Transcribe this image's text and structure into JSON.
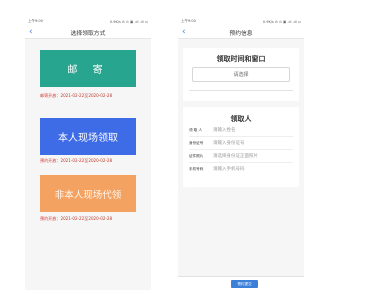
{
  "left": {
    "status": {
      "time": "上午9:00",
      "icons": "0.9K/s ✆ ⊙ ▣ .ıll .ıll ▭"
    },
    "title": "选择领取方式",
    "options": [
      {
        "label": "邮 寄",
        "note_label": "邮寄开放：",
        "note_value": "2021-02-22至2020-02-28"
      },
      {
        "label": "本人现场领取",
        "note_label": "预约开放：",
        "note_value": "2021-02-22至2020-02-28"
      },
      {
        "label": "非本人现场代领",
        "note_label": "预约开放：",
        "note_value": "2021-02-22至2020-02-28"
      }
    ]
  },
  "right": {
    "status": {
      "time": "上午9:00",
      "icons": "0.9K/s ✆ ⊙ ▣ .ıll .ıll ▭"
    },
    "title": "预约信息",
    "time_section": {
      "title": "领取时间和窗口",
      "select_placeholder": "请选择"
    },
    "person_section": {
      "title": "领取人",
      "fields": [
        {
          "label": "领 取 人",
          "placeholder": "请输入姓名"
        },
        {
          "label": "身份证号",
          "placeholder": "请输入身份证号"
        },
        {
          "label": "证件照片",
          "placeholder": "请选择身份证正面照片"
        },
        {
          "label": "手机号码",
          "placeholder": "请输入手机号码"
        }
      ]
    },
    "submit_label": "预约提交"
  },
  "colors": {
    "teal": "#27a58f",
    "blue": "#3e6be6",
    "orange": "#f4a261",
    "accent": "#3b7fd9",
    "note_red": "#d0322b"
  }
}
